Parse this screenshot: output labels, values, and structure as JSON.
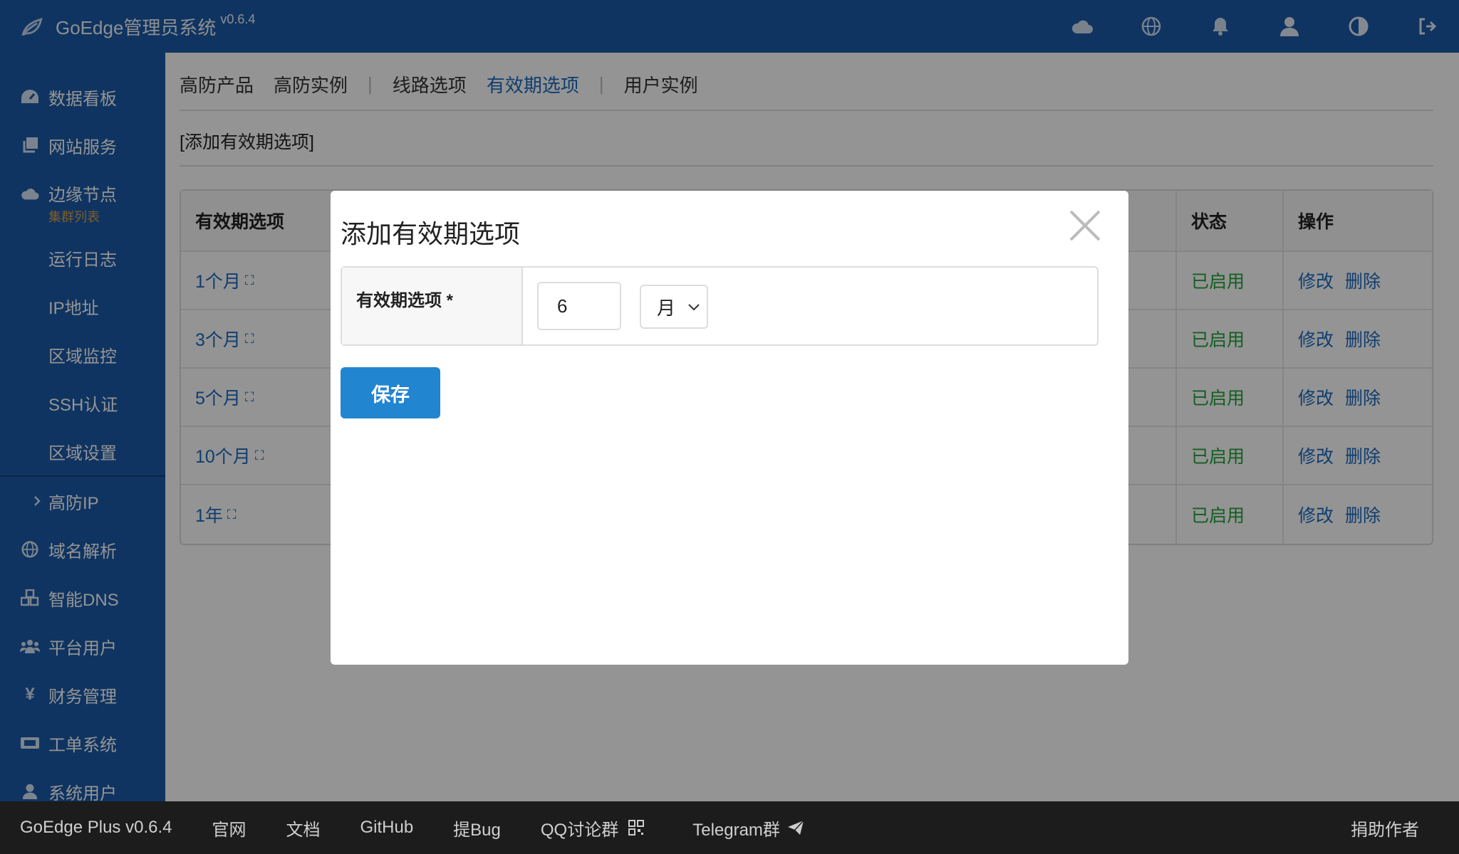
{
  "brand": {
    "title": "GoEdge管理员系统",
    "version": "v0.6.4"
  },
  "topIcons": [
    "cloud-icon",
    "globe-icon",
    "bell-icon",
    "user-icon",
    "contrast-icon",
    "logout-icon"
  ],
  "sidebar": {
    "items": [
      {
        "label": "数据看板",
        "icon": "dashboard-icon"
      },
      {
        "label": "网站服务",
        "icon": "copy-icon"
      },
      {
        "label": "边缘节点",
        "icon": "cloud-icon",
        "sub": "集群列表"
      }
    ],
    "subItems": [
      "运行日志",
      "IP地址",
      "区域监控",
      "SSH认证",
      "区域设置"
    ],
    "expandItem": "高防IP",
    "bottomItems": [
      {
        "label": "域名解析",
        "icon": "globe-icon"
      },
      {
        "label": "智能DNS",
        "icon": "cubes-icon"
      },
      {
        "label": "平台用户",
        "icon": "users-icon"
      },
      {
        "label": "财务管理",
        "icon": "yen-icon"
      },
      {
        "label": "工单系统",
        "icon": "ticket-icon"
      },
      {
        "label": "系统用户",
        "icon": "user-icon"
      }
    ]
  },
  "tabs": [
    "高防产品",
    "高防实例",
    "线路选项",
    "有效期选项",
    "用户实例"
  ],
  "subLink": "[添加有效期选项]",
  "table": {
    "headers": [
      "有效期选项",
      "状态",
      "操作"
    ],
    "rows": [
      {
        "name": "1个月",
        "status": "已启用"
      },
      {
        "name": "3个月",
        "status": "已启用"
      },
      {
        "name": "5个月",
        "status": "已启用"
      },
      {
        "name": "10个月",
        "status": "已启用"
      },
      {
        "name": "1年",
        "status": "已启用"
      }
    ],
    "actions": [
      "修改",
      "删除"
    ]
  },
  "modal": {
    "title": "添加有效期选项",
    "fieldLabel": "有效期选项 *",
    "countValue": "6",
    "unitValue": "月",
    "saveLabel": "保存"
  },
  "footer": {
    "items": [
      "GoEdge Plus v0.6.4",
      "官网",
      "文档",
      "GitHub",
      "提Bug",
      "QQ讨论群",
      "Telegram群"
    ],
    "right": "捐助作者"
  }
}
